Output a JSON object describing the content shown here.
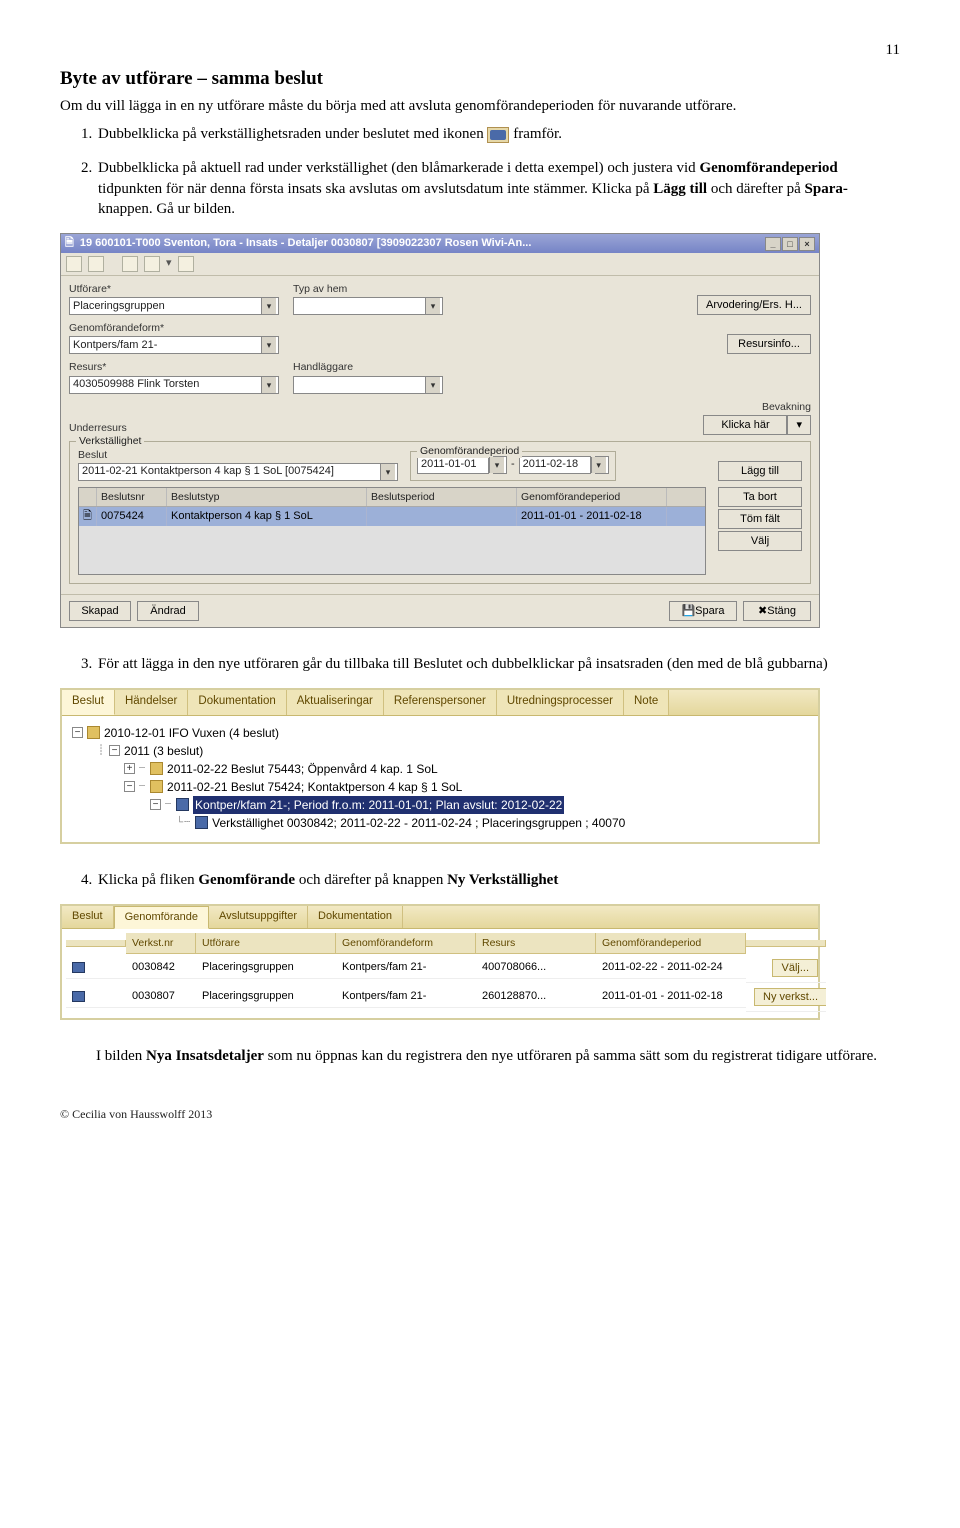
{
  "page_number": "11",
  "heading": "Byte av utförare – samma beslut",
  "intro": "Om du vill lägga in en ny utförare måste du börja med att avsluta genomförandeperioden för nuvarande utförare.",
  "steps": {
    "s1a": "Dubbelklicka på verkställighetsraden under beslutet med ikonen ",
    "s1b": "framför.",
    "s2a": "Dubbelklicka på aktuell rad under verkställighet (den blåmarkerade i detta exempel) och justera vid ",
    "s2b": "Genomförandeperiod",
    "s2c": " tidpunkten för när denna första insats ska avslutas om avslutsdatum inte stämmer. Klicka på ",
    "s2d": "Lägg till",
    "s2e": " och därefter på ",
    "s2f": "Spara-",
    "s2g": "knappen. Gå ur bilden.",
    "s3": "För att lägga in den nye utföraren går du tillbaka till Beslutet och dubbelklickar på insatsraden (den med de blå gubbarna)",
    "s4a": "Klicka på fliken ",
    "s4b": "Genomförande",
    "s4c": " och därefter på knappen ",
    "s4d": "Ny Verkställighet",
    "closing_a": "I bilden ",
    "closing_b": "Nya Insatsdetaljer",
    "closing_c": " som nu öppnas kan du registrera den nye utföraren på samma sätt som du registrerat tidigare utförare."
  },
  "dialog": {
    "title": "19 600101-T000  Sventon, Tora  -  Insats - Detaljer  0030807   [3909022307 Rosen Wivi-An...",
    "labels": {
      "utforare": "Utförare*",
      "typ_av_hem": "Typ av hem",
      "genomforandeform": "Genomförandeform*",
      "resurs": "Resurs*",
      "handlaggare": "Handläggare",
      "underresurs": "Underresurs",
      "bevakning": "Bevakning",
      "verkstalllighet": "Verkställighet",
      "beslut": "Beslut",
      "genomforandeperiod": "Genomförandeperiod"
    },
    "values": {
      "utforare": "Placeringsgruppen",
      "genomforandeform": "Kontpers/fam 21-",
      "resurs": "4030509988 Flink Torsten",
      "beslut": "2011-02-21 Kontaktperson 4 kap § 1 SoL [0075424]",
      "period_from": "2011-01-01",
      "period_to": "2011-02-18"
    },
    "buttons": {
      "arvodering": "Arvodering/Ers. H...",
      "resursinfo": "Resursinfo...",
      "klicka_har": "Klicka här",
      "lagg_till": "Lägg till",
      "ta_bort": "Ta bort",
      "tom_falt": "Töm fält",
      "valj": "Välj",
      "skapad": "Skapad",
      "andrad": "Ändrad",
      "spara": "Spara",
      "stang": "Stäng"
    },
    "list_headers": {
      "beslutsnr": "Beslutsnr",
      "beslutstyp": "Beslutstyp",
      "beslutsperiod": "Beslutsperiod",
      "genomforandeperiod": "Genomförandeperiod"
    },
    "list_row": {
      "beslutsnr": "0075424",
      "beslutstyp": "Kontaktperson 4 kap § 1 SoL",
      "genomforandeperiod": "2011-01-01 - 2011-02-18"
    }
  },
  "panel2": {
    "tabs": [
      "Beslut",
      "Händelser",
      "Dokumentation",
      "Aktualiseringar",
      "Referenspersoner",
      "Utredningsprocesser",
      "Note"
    ],
    "root": "2010-12-01  IFO Vuxen  (4 beslut)",
    "y2011": "2011   (3 beslut)",
    "line1": "2011-02-22  Beslut 75443; Öppenvård  4 kap. 1 SoL",
    "line2": "2011-02-21  Beslut 75424; Kontaktperson 4 kap § 1 SoL",
    "line3_sel": "Kontper/kfam 21-; Period fr.o.m: 2011-01-01; Plan avslut: 2012-02-22",
    "line4": "Verkställighet 0030842; 2011-02-22 - 2011-02-24 ; Placeringsgruppen ; 40070"
  },
  "panel3": {
    "tabs": [
      "Beslut",
      "Genomförande",
      "Avslutsuppgifter",
      "Dokumentation"
    ],
    "headers": {
      "verkstnr": "Verkst.nr",
      "utforare": "Utförare",
      "genomforandeform": "Genomförandeform",
      "resurs": "Resurs",
      "genomforandeperiod": "Genomförandeperiod"
    },
    "rows": [
      {
        "nr": "0030842",
        "utf": "Placeringsgruppen",
        "form": "Kontpers/fam 21-",
        "res": "400708066...",
        "per": "2011-02-22 - 2011-02-24"
      },
      {
        "nr": "0030807",
        "utf": "Placeringsgruppen",
        "form": "Kontpers/fam 21-",
        "res": "260128870...",
        "per": "2011-01-01 - 2011-02-18"
      }
    ],
    "buttons": {
      "valj": "Välj...",
      "ny": "Ny verkst..."
    }
  },
  "footer": "© Cecilia von Hausswolff 2013"
}
